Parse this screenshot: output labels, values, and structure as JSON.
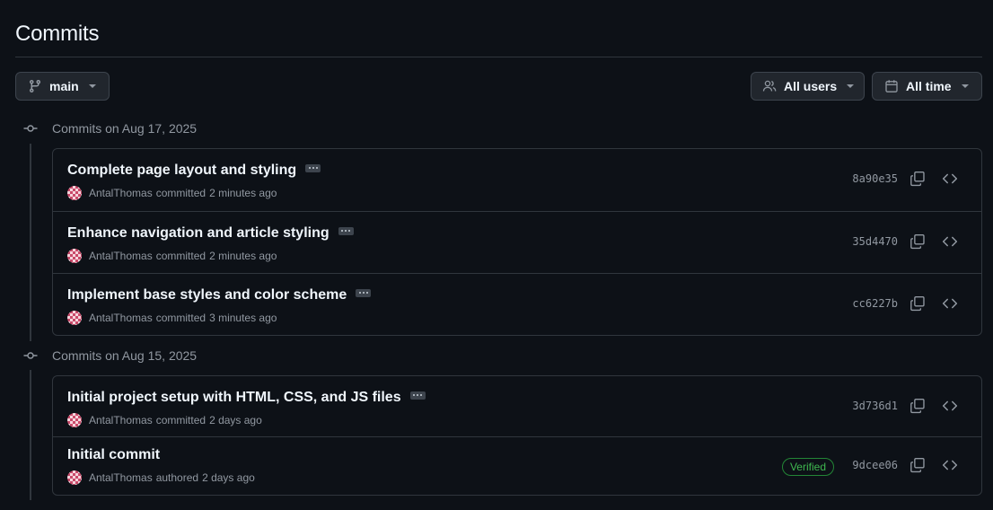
{
  "page": {
    "title": "Commits"
  },
  "filters": {
    "branch": {
      "label": "main",
      "icon": "git-branch-icon"
    },
    "users": {
      "label": "All users",
      "icon": "people-icon"
    },
    "time": {
      "label": "All time",
      "icon": "calendar-icon"
    }
  },
  "groups": [
    {
      "heading": "Commits on Aug 17, 2025",
      "commits": [
        {
          "message": "Complete page layout and styling",
          "author": "AntalThomas",
          "action": "committed",
          "time": "2 minutes ago",
          "sha": "8a90e35",
          "verified": ""
        },
        {
          "message": "Enhance navigation and article styling",
          "author": "AntalThomas",
          "action": "committed",
          "time": "2 minutes ago",
          "sha": "35d4470",
          "verified": ""
        },
        {
          "message": "Implement base styles and color scheme",
          "author": "AntalThomas",
          "action": "committed",
          "time": "3 minutes ago",
          "sha": "cc6227b",
          "verified": ""
        }
      ]
    },
    {
      "heading": "Commits on Aug 15, 2025",
      "commits": [
        {
          "message": "Initial project setup with HTML, CSS, and JS files",
          "author": "AntalThomas",
          "action": "committed",
          "time": "2 days ago",
          "sha": "3d736d1",
          "verified": ""
        },
        {
          "message": "Initial commit",
          "author": "AntalThomas",
          "action": "authored",
          "time": "2 days ago",
          "sha": "9dcee06",
          "verified": "Verified"
        }
      ]
    }
  ],
  "colors": {
    "background": "#0d1117",
    "border": "#30363d",
    "muted": "#9198a1",
    "verified": "#3fb950"
  }
}
